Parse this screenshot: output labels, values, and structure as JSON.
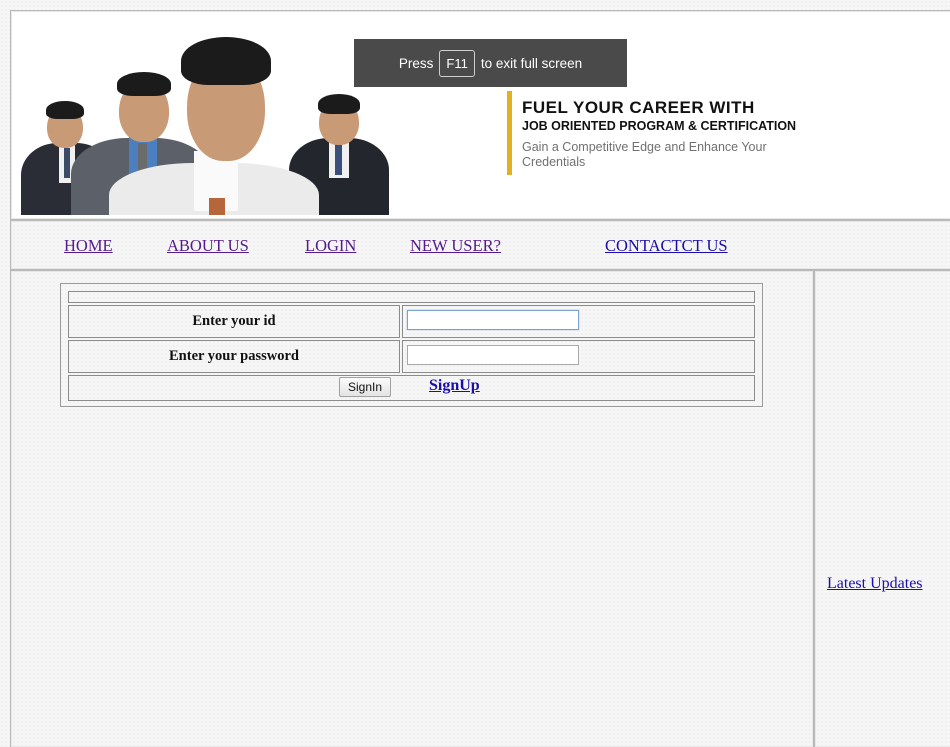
{
  "fullscreen_notice": {
    "press": "Press",
    "key": "F11",
    "message": "to exit full screen"
  },
  "banner": {
    "headline": "FUEL YOUR CAREER WITH",
    "subheadline": "JOB ORIENTED PROGRAM & CERTIFICATION",
    "tagline": "Gain a Competitive Edge and Enhance Your Credentials",
    "accent_color": "#e2b021"
  },
  "nav": {
    "home": "HOME",
    "about": "ABOUT US",
    "login": "LOGIN",
    "new_user": "NEW USER?",
    "contact": "CONTACTCT US"
  },
  "login_form": {
    "id_label": "Enter your id",
    "id_value": "",
    "password_label": "Enter your password",
    "password_value": "",
    "signin_label": "SignIn",
    "signup_label": "SignUp"
  },
  "sidebar": {
    "latest_updates": "Latest Updates"
  }
}
